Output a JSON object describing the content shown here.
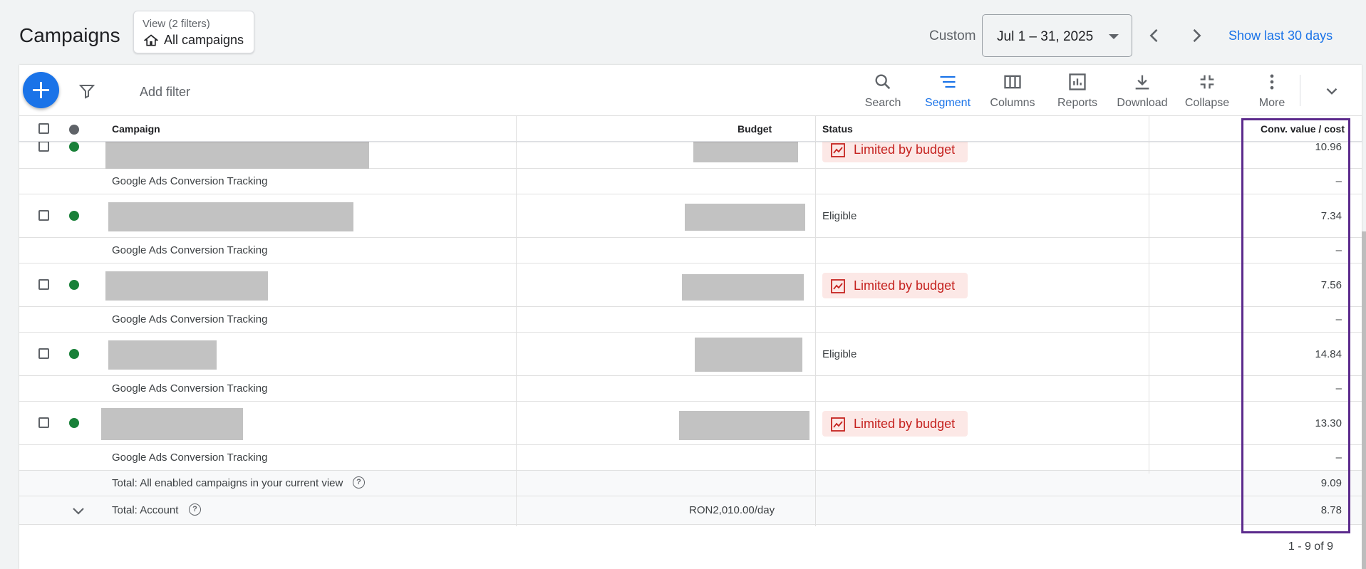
{
  "header": {
    "title": "Campaigns",
    "view_sub": "View (2 filters)",
    "view_main": "All campaigns",
    "custom_label": "Custom",
    "date_range": "Jul 1 – 31, 2025",
    "show_last": "Show last 30 days"
  },
  "toolbar": {
    "add_filter": "Add filter",
    "tools": [
      {
        "label": "Search",
        "icon": "search-icon"
      },
      {
        "label": "Segment",
        "icon": "segment-icon"
      },
      {
        "label": "Columns",
        "icon": "columns-icon"
      },
      {
        "label": "Reports",
        "icon": "reports-icon"
      },
      {
        "label": "Download",
        "icon": "download-icon"
      },
      {
        "label": "Collapse",
        "icon": "collapse-icon"
      },
      {
        "label": "More",
        "icon": "more-vert-icon"
      }
    ]
  },
  "table": {
    "headers": {
      "campaign": "Campaign",
      "budget": "Budget",
      "status": "Status",
      "conv_value_cost": "Conv. value / cost"
    },
    "rows": [
      {
        "status": "Limited by budget",
        "value": "10.96",
        "sub_label": "Google Ads Conversion Tracking",
        "sub_value": "–"
      },
      {
        "status": "Eligible",
        "value": "7.34",
        "sub_label": "Google Ads Conversion Tracking",
        "sub_value": "–"
      },
      {
        "status": "Limited by budget",
        "value": "7.56",
        "sub_label": "Google Ads Conversion Tracking",
        "sub_value": "–"
      },
      {
        "status": "Eligible",
        "value": "14.84",
        "sub_label": "Google Ads Conversion Tracking",
        "sub_value": "–"
      },
      {
        "status": "Limited by budget",
        "value": "13.30",
        "sub_label": "Google Ads Conversion Tracking",
        "sub_value": "–"
      }
    ],
    "total_view": {
      "label": "Total: All enabled campaigns in your current view",
      "value": "9.09"
    },
    "total_account": {
      "label": "Total: Account",
      "budget": "RON2,010.00/day",
      "value": "8.78"
    },
    "pagination": "1 - 9 of 9"
  },
  "colors": {
    "accent": "#1a73e8",
    "limited_text": "#c5221f",
    "limited_bg": "#fce8e6",
    "enabled_dot": "#188038",
    "highlight": "#5b2a8c"
  }
}
